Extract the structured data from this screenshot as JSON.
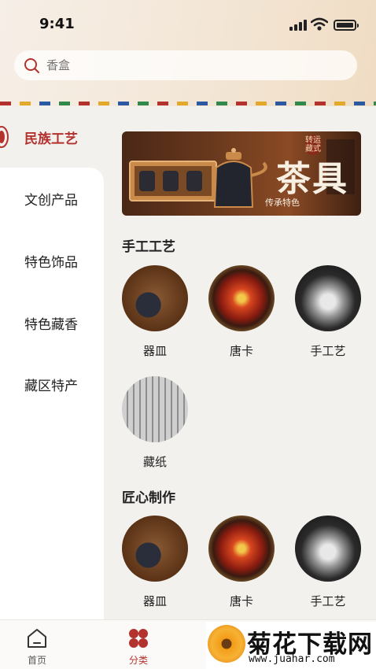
{
  "status": {
    "time": "9:41"
  },
  "search": {
    "placeholder": "香盒"
  },
  "sidebar": {
    "items": [
      {
        "label": "民族工艺",
        "active": true
      },
      {
        "label": "文创产品",
        "active": false
      },
      {
        "label": "特色饰品",
        "active": false
      },
      {
        "label": "特色藏香",
        "active": false
      },
      {
        "label": "藏区特产",
        "active": false
      }
    ]
  },
  "banner": {
    "title": "茶具",
    "subtitle": "传承特色",
    "tag": "转运藏式"
  },
  "sections": [
    {
      "title": "手工工艺",
      "items": [
        {
          "label": "器皿",
          "image": "vessel-teapot"
        },
        {
          "label": "唐卡",
          "image": "thangka-painting"
        },
        {
          "label": "手工艺",
          "image": "silver-craft"
        },
        {
          "label": "藏纸",
          "image": "tibetan-paper"
        }
      ]
    },
    {
      "title": "匠心制作",
      "items": [
        {
          "label": "器皿",
          "image": "vessel-teapot"
        },
        {
          "label": "唐卡",
          "image": "thangka-painting"
        },
        {
          "label": "手工艺",
          "image": "silver-craft"
        }
      ]
    }
  ],
  "tabbar": {
    "tabs": [
      {
        "label": "首页",
        "icon": "home-icon",
        "active": false
      },
      {
        "label": "分类",
        "icon": "category-icon",
        "active": true
      }
    ]
  },
  "watermark": {
    "name": "菊花下载网",
    "url": "www.juahar.com"
  },
  "colors": {
    "accent": "#b3322e",
    "background": "#f3f1ee"
  }
}
